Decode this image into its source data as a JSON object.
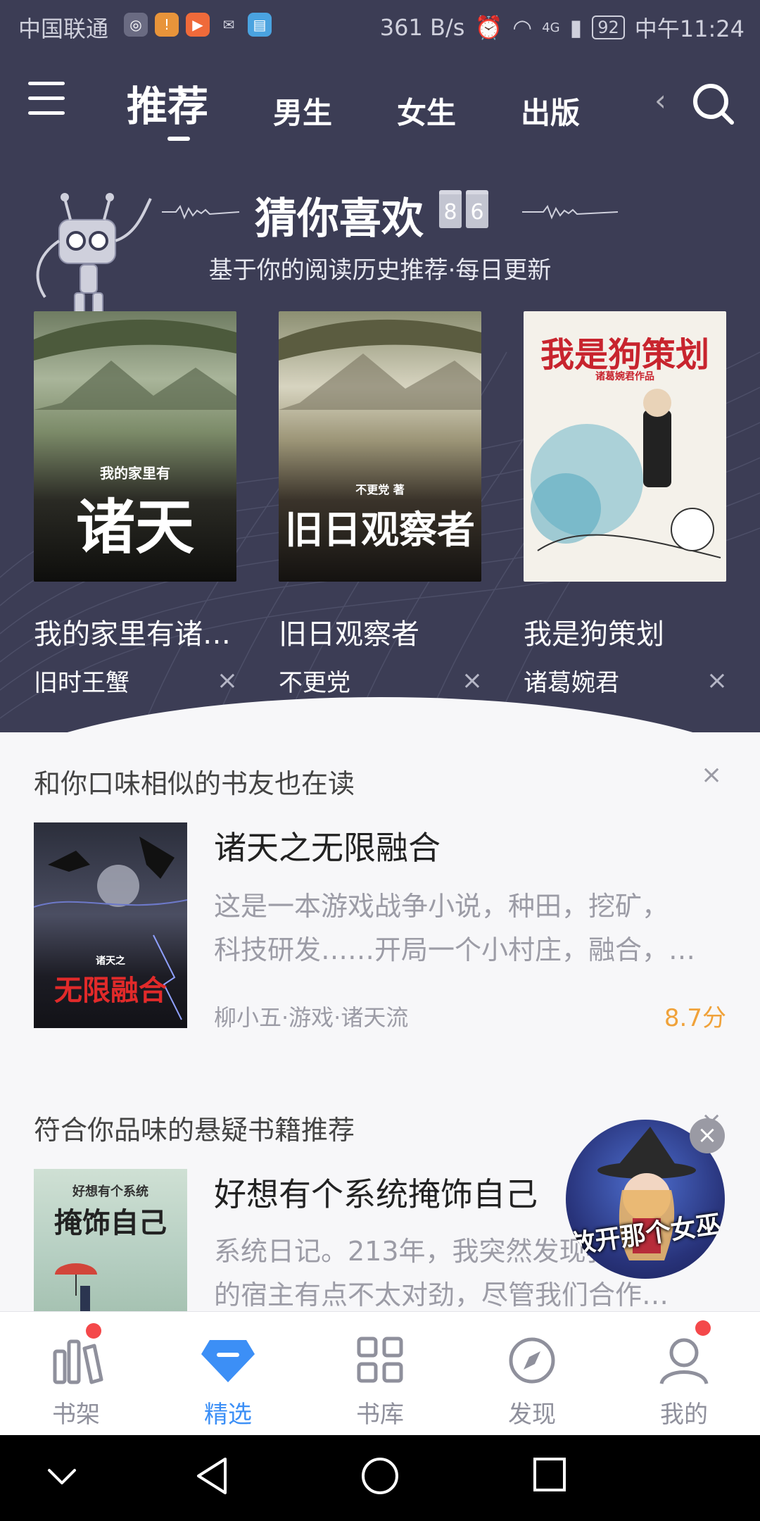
{
  "status_bar": {
    "carrier": "中国联通",
    "net_speed": "361 B/s",
    "signal": "4G",
    "battery": "92",
    "time": "中午11:24"
  },
  "top_nav": {
    "tabs": [
      "推荐",
      "男生",
      "女生",
      "出版"
    ],
    "overflow_tab_fragment": "‹",
    "active_tab": "推荐"
  },
  "guess": {
    "title": "猜你喜欢",
    "counter": [
      "8",
      "6"
    ],
    "subtitle": "基于你的阅读历史推荐·每日更新",
    "books": [
      {
        "title": "我的家里有诸…",
        "author": "旧时王蟹",
        "cover_text": "诸天",
        "cover_tag": "我的家里有",
        "cover_icon": "misty-mountain-cover"
      },
      {
        "title": "旧日观察者",
        "author": "不更党",
        "cover_text": "旧日观察者",
        "cover_tag": "不更党 著",
        "cover_icon": "misty-mountain-cover"
      },
      {
        "title": "我是狗策划",
        "author": "诸葛婉君",
        "cover_text": "我是狗策划",
        "cover_tag": "诸葛婉君作品",
        "cover_icon": "cartoon-cover"
      }
    ],
    "close_glyph": "×"
  },
  "section1": {
    "heading": "和你口味相似的书友也在读",
    "close_glyph": "×",
    "book": {
      "title": "诸天之无限融合",
      "desc_line1": "这是一本游戏战争小说，种田，挖矿，",
      "desc_line2": "科技研发……开局一个小村庄，融合，…",
      "meta": "柳小五·游戏·诸天流",
      "score": "8.7分",
      "cover_tag": "诸天之",
      "cover_text": "无限融合"
    }
  },
  "section2": {
    "heading": "符合你品味的悬疑书籍推荐",
    "close_glyph": "×",
    "book": {
      "title": "好想有个系统掩饰自己",
      "desc_line1": "系统日记。213年，我突然发现我…",
      "desc_line2": "的宿主有点不太对劲，尽管我们合作…",
      "cover_tag": "好想有个系统",
      "cover_text": "掩饰自己"
    }
  },
  "float_ad": {
    "text": "放开那个女巫",
    "close_glyph": "×"
  },
  "bottom_tabs": [
    {
      "label": "书架",
      "icon": "bookshelf-icon"
    },
    {
      "label": "精选",
      "icon": "diamond-icon"
    },
    {
      "label": "书库",
      "icon": "grid-icon"
    },
    {
      "label": "发现",
      "icon": "compass-icon"
    },
    {
      "label": "我的",
      "icon": "profile-icon"
    }
  ],
  "colors": {
    "header_bg": "#3c3d55",
    "accent": "#3c8ff6",
    "score": "#f0a23a",
    "badge": "#f4484a"
  }
}
